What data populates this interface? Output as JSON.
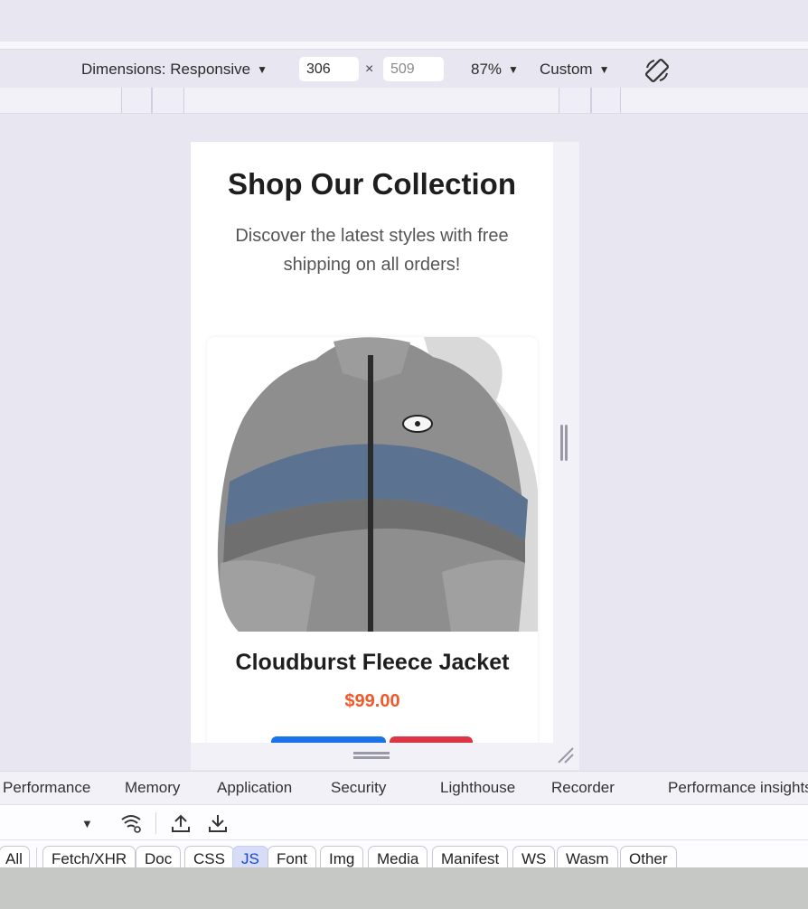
{
  "toolbar": {
    "dimensions_label": "Dimensions: Responsive",
    "width_value": "306",
    "height_placeholder": "509",
    "times": "×",
    "zoom": "87%",
    "throttle": "Custom"
  },
  "page": {
    "title": "Shop Our Collection",
    "subtitle": "Discover the latest styles with free shipping on all orders!",
    "product": {
      "name": "Cloudburst Fleece Jacket",
      "price": "$99.00"
    }
  },
  "panel_tabs": [
    "Performance",
    "Memory",
    "Application",
    "Security",
    "Lighthouse",
    "Recorder",
    "Performance insights"
  ],
  "filters": [
    "All",
    "Fetch/XHR",
    "Doc",
    "CSS",
    "JS",
    "Font",
    "Img",
    "Media",
    "Manifest",
    "WS",
    "Wasm",
    "Other"
  ],
  "active_filter": "JS",
  "colors": {
    "accent_price": "#f0592b",
    "button_primary": "#1a73e8",
    "button_danger": "#dc3545"
  }
}
